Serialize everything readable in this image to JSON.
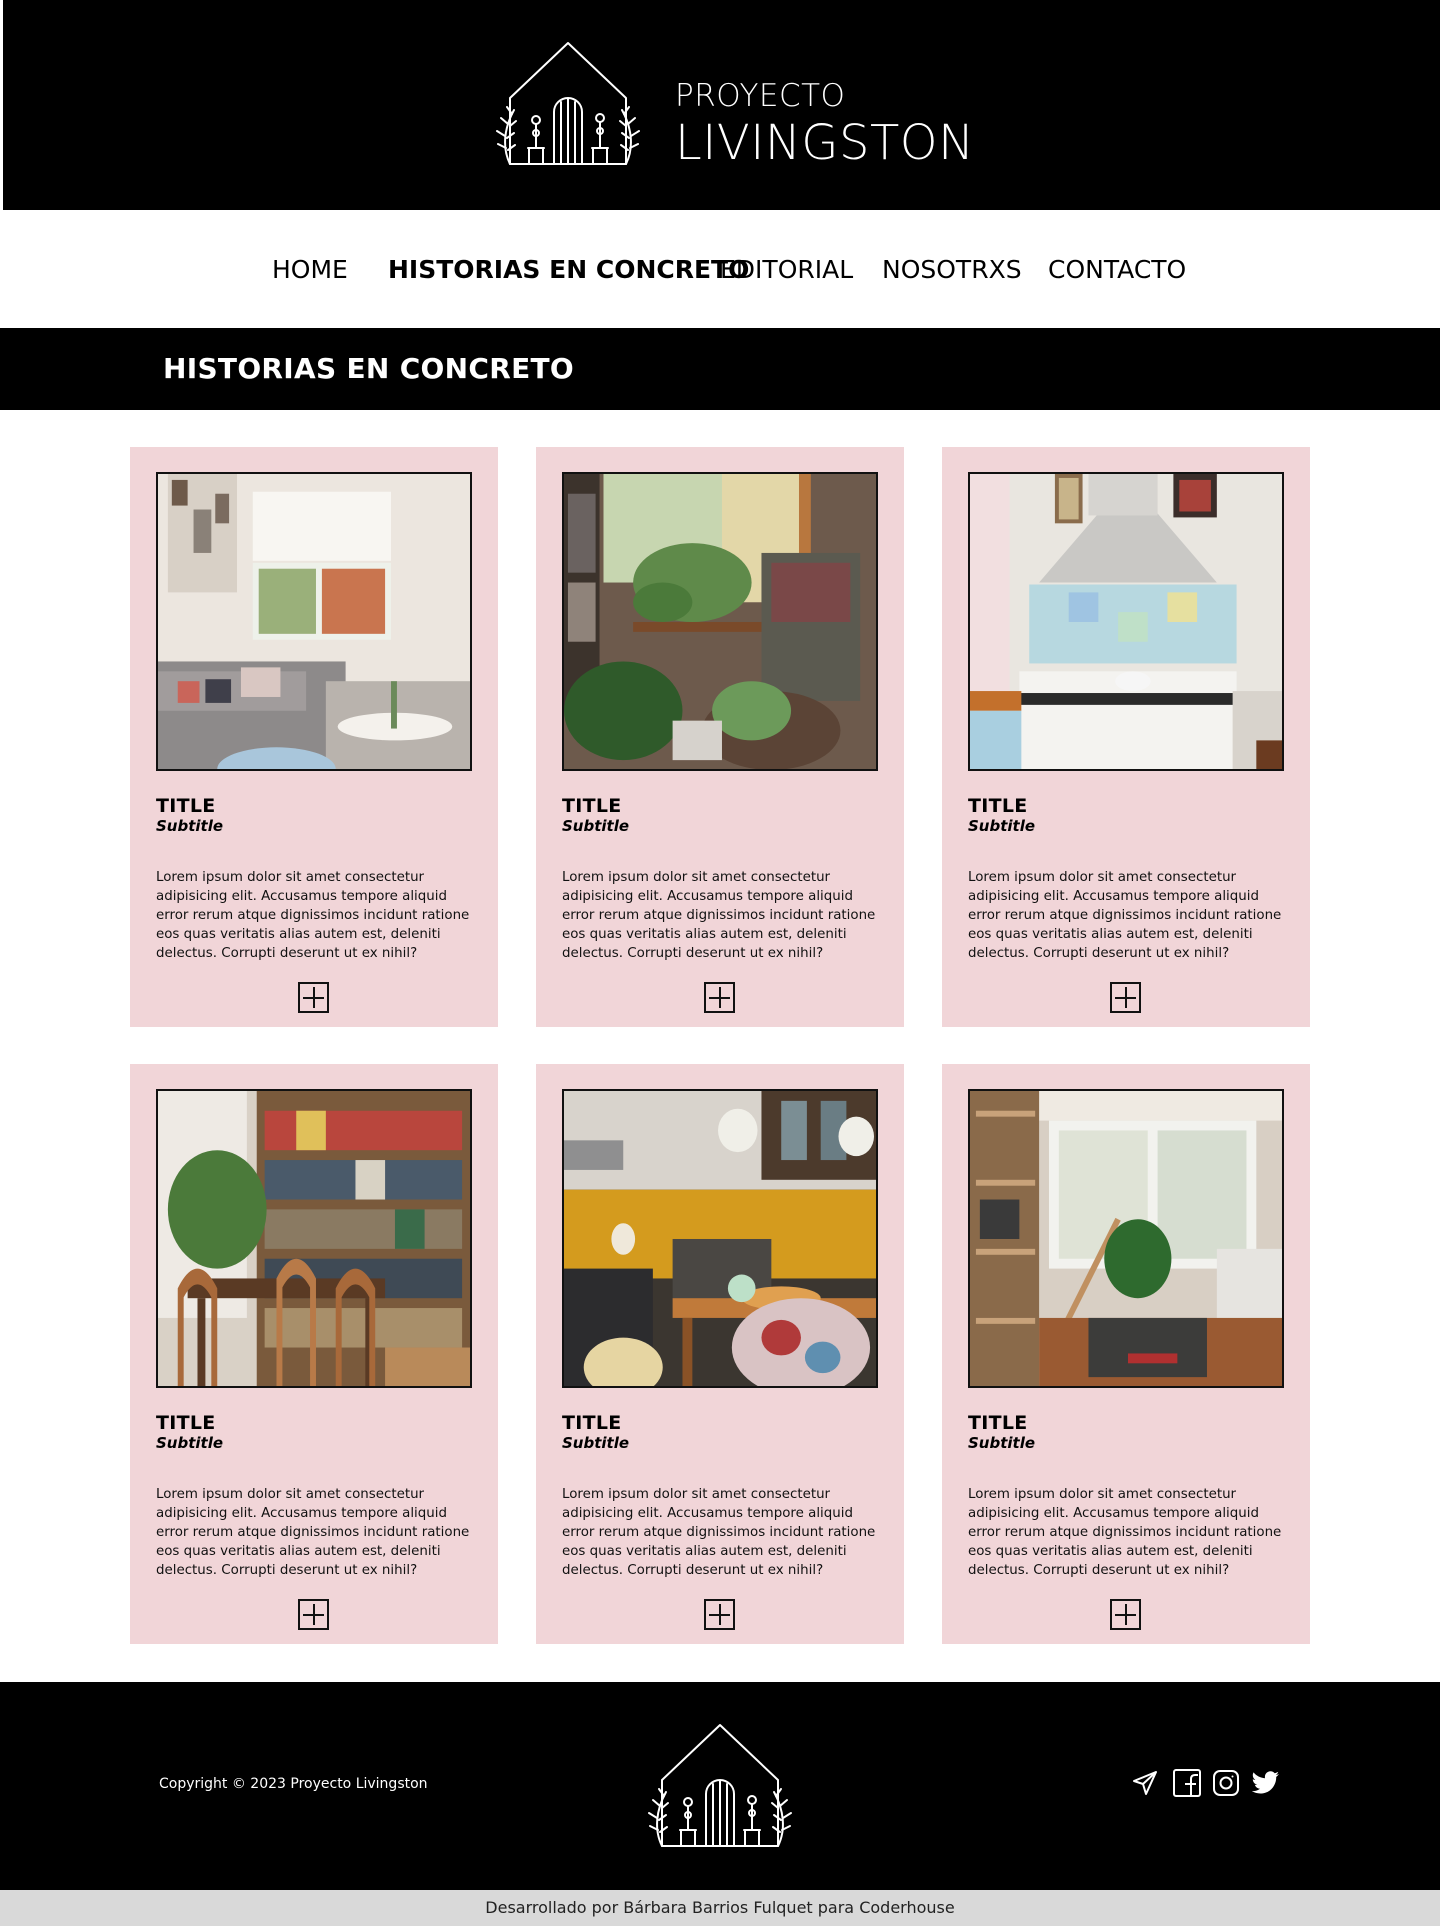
{
  "brand": {
    "line1": "PROYECTO",
    "line2": "LIVINGSTON"
  },
  "nav": {
    "items": [
      {
        "label": "HOME",
        "active": false
      },
      {
        "label": "HISTORIAS EN CONCRETO",
        "active": true
      },
      {
        "label": "EDITORIAL",
        "active": false
      },
      {
        "label": "NOSOTRXS",
        "active": false
      },
      {
        "label": "CONTACTO",
        "active": false
      }
    ]
  },
  "section": {
    "title": "HISTORIAS EN CONCRETO"
  },
  "cards": [
    {
      "title": "TITLE",
      "subtitle": "Subtitle",
      "body": "Lorem ipsum dolor sit amet consectetur adipisicing elit. Accusamus tempore aliquid error rerum atque dignissimos incidunt ratione eos quas veritatis alias autem est, deleniti delectus. Corrupti deserunt ut ex nihil?",
      "image": "living-room-photo"
    },
    {
      "title": "TITLE",
      "subtitle": "Subtitle",
      "body": "Lorem ipsum dolor sit amet consectetur adipisicing elit. Accusamus tempore aliquid error rerum atque dignissimos incidunt ratione eos quas veritatis alias autem est, deleniti delectus. Corrupti deserunt ut ex nihil?",
      "image": "plant-corner-photo"
    },
    {
      "title": "TITLE",
      "subtitle": "Subtitle",
      "body": "Lorem ipsum dolor sit amet consectetur adipisicing elit. Accusamus tempore aliquid error rerum atque dignissimos incidunt ratione eos quas veritatis alias autem est, deleniti delectus. Corrupti deserunt ut ex nihil?",
      "image": "kitchen-stove-photo"
    },
    {
      "title": "TITLE",
      "subtitle": "Subtitle",
      "body": "Lorem ipsum dolor sit amet consectetur adipisicing elit. Accusamus tempore aliquid error rerum atque dignissimos incidunt ratione eos quas veritatis alias autem est, deleniti delectus. Corrupti deserunt ut ex nihil?",
      "image": "dining-bookshelf-photo"
    },
    {
      "title": "TITLE",
      "subtitle": "Subtitle",
      "body": "Lorem ipsum dolor sit amet consectetur adipisicing elit. Accusamus tempore aliquid error rerum atque dignissimos incidunt ratione eos quas veritatis alias autem est, deleniti delectus. Corrupti deserunt ut ex nihil?",
      "image": "yellow-kitchen-photo"
    },
    {
      "title": "TITLE",
      "subtitle": "Subtitle",
      "body": "Lorem ipsum dolor sit amet consectetur adipisicing elit. Accusamus tempore aliquid error rerum atque dignissimos incidunt ratione eos quas veritatis alias autem est, deleniti delectus. Corrupti deserunt ut ex nihil?",
      "image": "balcony-window-photo"
    }
  ],
  "footer": {
    "copyright": "Copyright © 2023 Proyecto Livingston",
    "social": [
      "send-icon",
      "facebook-icon",
      "instagram-icon",
      "twitter-icon"
    ]
  },
  "credits": "Desarrollado por Bárbara Barrios Fulquet para Coderhouse",
  "colors": {
    "header_bg": "#000000",
    "card_bg": "#f1d5d8",
    "credits_bg": "#d9d9d9"
  }
}
